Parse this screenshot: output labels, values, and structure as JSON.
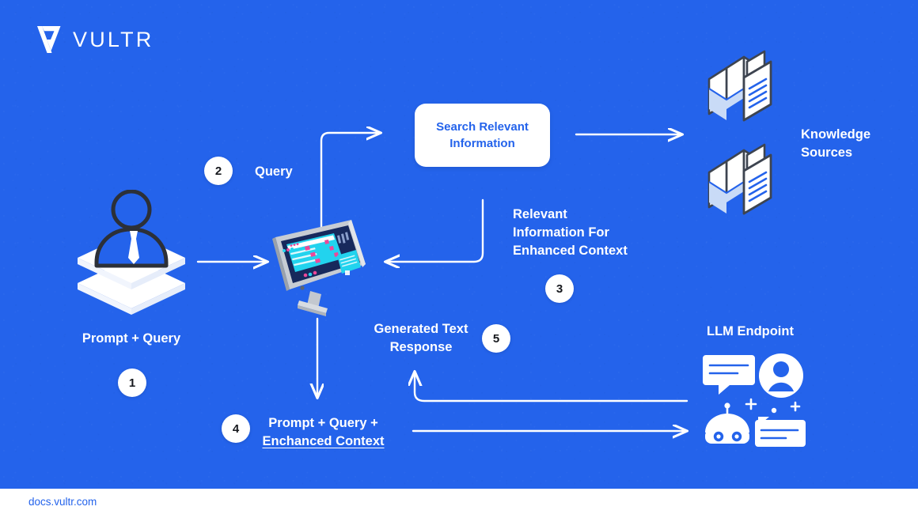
{
  "brand": {
    "logo_icon": "vultr-v-logo-icon",
    "name": "VULTR"
  },
  "theme": {
    "background": "#2463eb",
    "surface": "#ffffff",
    "accent_text": "#2463eb",
    "label_text": "#ffffff",
    "doc_outline": "#3d4450",
    "doc_line": "#2463eb",
    "doc_shade": "#c9dbf7",
    "screen_dark": "#17295c",
    "screen_cyan": "#22d3ee",
    "screen_pink": "#ec4899",
    "monitor_frame": "#b9bec6"
  },
  "diagram": {
    "title": "RAG architecture flow",
    "nodes": [
      {
        "id": "user",
        "label": "Prompt + Query",
        "icon": "user-on-layers-icon"
      },
      {
        "id": "search",
        "label": "Search Relevant\nInformation",
        "icon": "search-box"
      },
      {
        "id": "knowledge",
        "label": "Knowledge\nSources",
        "icon": "documents-stack-icon"
      },
      {
        "id": "computer",
        "label": "",
        "icon": "desktop-monitor-icon"
      },
      {
        "id": "llm",
        "label": "LLM Endpoint",
        "icon": "llm-cluster-icon"
      }
    ],
    "steps": [
      {
        "number": "1",
        "label": "Prompt + Query"
      },
      {
        "number": "2",
        "label": "Query"
      },
      {
        "number": "3",
        "label": "Relevant\nInformation For\nEnhanced Context"
      },
      {
        "number": "4",
        "label_line1": "Prompt + Query +",
        "label_line2": "Enchanced Context"
      },
      {
        "number": "5",
        "label": "Generated Text\nResponse"
      }
    ]
  },
  "footer": {
    "link": "docs.vultr.com"
  }
}
